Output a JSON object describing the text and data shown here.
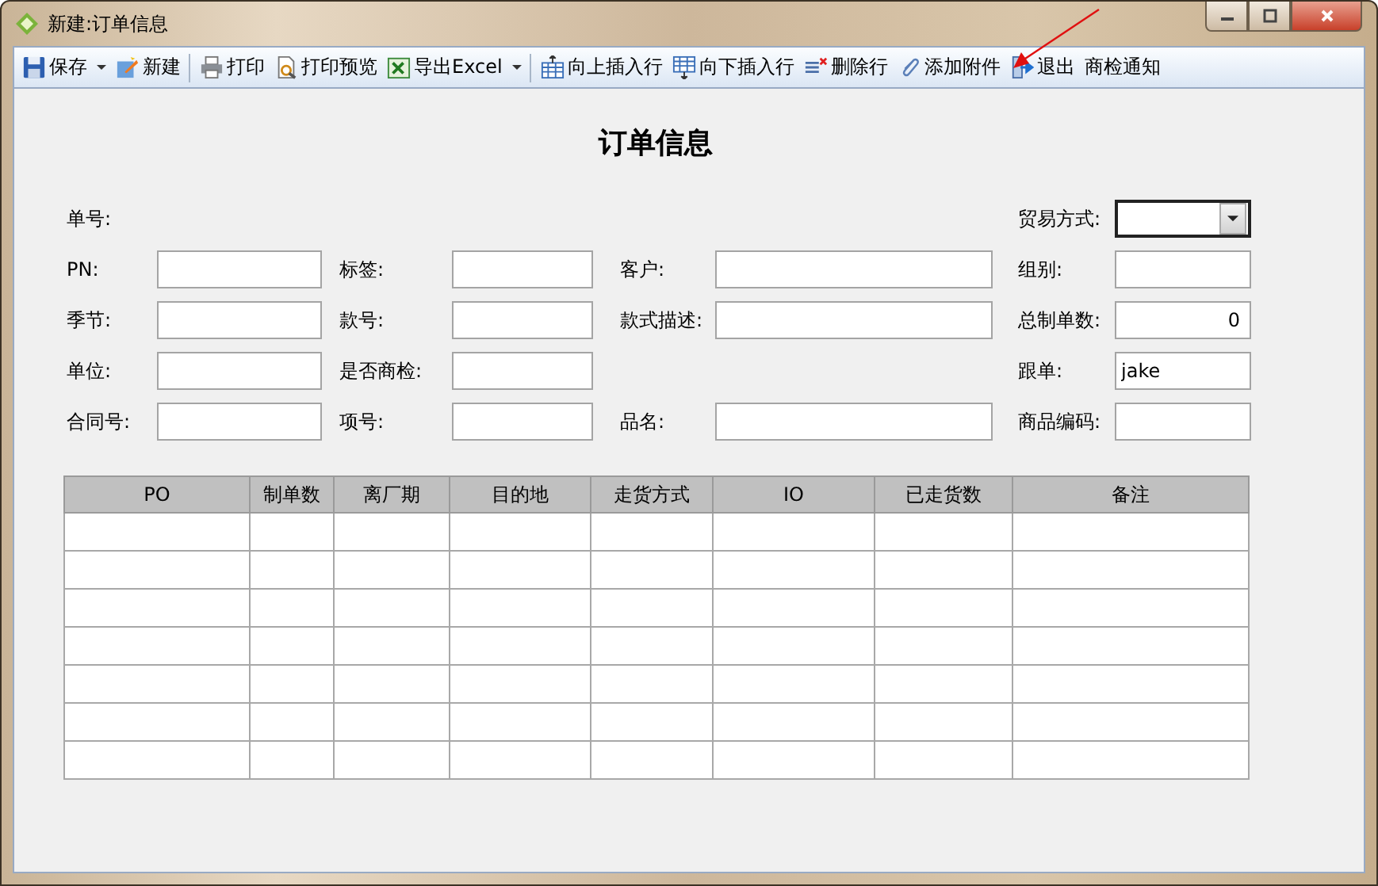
{
  "window": {
    "title": "新建:订单信息"
  },
  "toolbar": [
    {
      "label": "保存",
      "kind": "save",
      "dropdown": true,
      "separator_after": false
    },
    {
      "label": "新建",
      "kind": "new",
      "dropdown": false,
      "separator_after": true
    },
    {
      "label": "打印",
      "kind": "print",
      "dropdown": false,
      "separator_after": false
    },
    {
      "label": "打印预览",
      "kind": "preview",
      "dropdown": false,
      "separator_after": false
    },
    {
      "label": "导出Excel",
      "kind": "export",
      "dropdown": true,
      "separator_after": true
    },
    {
      "label": "向上插入行",
      "kind": "insertabove",
      "dropdown": false,
      "separator_after": false
    },
    {
      "label": "向下插入行",
      "kind": "insertbelow",
      "dropdown": false,
      "separator_after": false
    },
    {
      "label": "删除行",
      "kind": "deleterow",
      "dropdown": false,
      "separator_after": false
    },
    {
      "label": "添加附件",
      "kind": "attach",
      "dropdown": false,
      "separator_after": false
    },
    {
      "label": "退出",
      "kind": "exit",
      "dropdown": false,
      "separator_after": false
    },
    {
      "label": "商检通知",
      "kind": "text",
      "dropdown": false,
      "separator_after": false
    }
  ],
  "form": {
    "title": "订单信息",
    "rows": [
      [
        {
          "label": "单号:",
          "kind": "label"
        },
        null,
        null,
        {
          "label": "贸易方式:",
          "kind": "dropdown"
        }
      ],
      [
        {
          "label": "PN:",
          "kind": "text"
        },
        {
          "label": "标签:",
          "kind": "text"
        },
        {
          "label": "客户:",
          "kind": "text"
        },
        {
          "label": "组别:",
          "kind": "text"
        }
      ],
      [
        {
          "label": "季节:",
          "kind": "text"
        },
        {
          "label": "款号:",
          "kind": "text"
        },
        {
          "label": "款式描述:",
          "kind": "text"
        },
        {
          "label": "总制单数:",
          "kind": "number",
          "value": "0"
        }
      ],
      [
        {
          "label": "单位:",
          "kind": "text"
        },
        {
          "label": "是否商检:",
          "kind": "text"
        },
        null,
        {
          "label": "跟单:",
          "kind": "text",
          "value": "jake"
        }
      ],
      [
        {
          "label": "合同号:",
          "kind": "text"
        },
        {
          "label": "项号:",
          "kind": "text"
        },
        {
          "label": "品名:",
          "kind": "text"
        },
        {
          "label": "商品编码:",
          "kind": "text"
        }
      ]
    ]
  },
  "table": {
    "columns": [
      "PO",
      "制单数",
      "离厂期",
      "目的地",
      "走货方式",
      "IO",
      "已走货数",
      "备注"
    ]
  }
}
